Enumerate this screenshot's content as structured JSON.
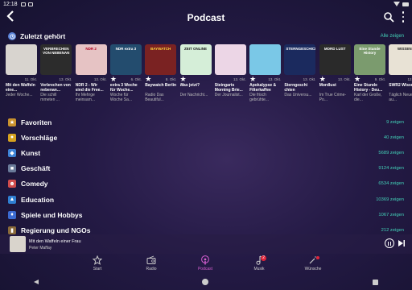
{
  "status_bar": {
    "time": "12:18"
  },
  "appbar": {
    "title": "Podcast"
  },
  "recent": {
    "title": "Zuletzt gehört",
    "show_all": "Alle zeigen",
    "items": [
      {
        "name": "Mit den Waffeln eine...",
        "sub": "Jeder Woche...",
        "date": "11. Okt.",
        "star": false,
        "thumb_bg": "#d8d4cf",
        "thumb_text": "",
        "thumb_color": "#222"
      },
      {
        "name": "Verbrechen von nebenan...",
        "sub": "Die schill mmeten ...",
        "date": "13. Okt.",
        "star": false,
        "thumb_bg": "#2c2c2c",
        "thumb_text": "VERBRECHEN VON NEBENAN",
        "thumb_color": "#fff"
      },
      {
        "name": "NDR 2 - Wir sind die Free...",
        "sub": "Ihr Mehrge meinsam...",
        "date": "13. Okt.",
        "star": false,
        "thumb_bg": "#e6c3c4",
        "thumb_text": "NDR 2",
        "thumb_color": "#b00020"
      },
      {
        "name": "extra 3 Woche für Woche...",
        "sub": "Woche für Woche Sa...",
        "date": "6. Okt.",
        "star": true,
        "thumb_bg": "#234c6e",
        "thumb_text": "NDR extra 3",
        "thumb_color": "#fff"
      },
      {
        "name": "Baywatch Berlin",
        "sub": "Radio Das Beautiful...",
        "date": "8. Okt.",
        "star": true,
        "thumb_bg": "#7a2222",
        "thumb_text": "BAYWATCH",
        "thumb_color": "#ffd33d"
      },
      {
        "name": "Was jetzt?",
        "sub": "Der Nachricht...",
        "date": "",
        "star": true,
        "thumb_bg": "#d5eed8",
        "thumb_text": "ZEIT ONLINE",
        "thumb_color": "#1a1a1a"
      },
      {
        "name": "Steingarts Morning Brie...",
        "sub": "Der Journalist...",
        "date": "13. Okt.",
        "star": false,
        "thumb_bg": "#ecd6e6",
        "thumb_text": "",
        "thumb_color": "#222"
      },
      {
        "name": "Apokalypse & Filterkaffee",
        "sub": "Die frisch gebrühte...",
        "date": "13. Okt.",
        "star": true,
        "thumb_bg": "#7ac8e7",
        "thumb_text": "",
        "thumb_color": "#222"
      },
      {
        "name": "Sterngeschi chten",
        "sub": "Das Universu...",
        "date": "13. Okt.",
        "star": false,
        "thumb_bg": "#1b2a5e",
        "thumb_text": "STERNGESCHICHTEN",
        "thumb_color": "#fff"
      },
      {
        "name": "Mordlust",
        "sub": "Im True Crime-Po...",
        "date": "13. Okt.",
        "star": true,
        "thumb_bg": "#2a2a2a",
        "thumb_text": "MORD LUST",
        "thumb_color": "#fff"
      },
      {
        "name": "Eine Stunde History - Deu...",
        "sub": "Karl der Große, die...",
        "date": "9. Okt.",
        "star": true,
        "thumb_bg": "#7b9b6e",
        "thumb_text": "Eine Stunde History",
        "thumb_color": "#fff"
      },
      {
        "name": "SWR2 Wissen",
        "sub": "Täglich Neues au...",
        "date": "12. Okt.",
        "star": false,
        "thumb_bg": "#e8e2d5",
        "thumb_text": "WISSEN",
        "thumb_color": "#222"
      }
    ]
  },
  "categories": [
    {
      "label": "Favoriten",
      "count": "9 zeigen",
      "icon": "star-icon",
      "glyph": "★",
      "color": "#c9922e"
    },
    {
      "label": "Vorschläge",
      "count": "40 zeigen",
      "icon": "bulb-icon",
      "glyph": "●",
      "color": "#d6a21f"
    },
    {
      "label": "Kunst",
      "count": "5689 zeigen",
      "icon": "palette-icon",
      "glyph": "◆",
      "color": "#3d83d6"
    },
    {
      "label": "Geschäft",
      "count": "9124 zeigen",
      "icon": "briefcase-icon",
      "glyph": "■",
      "color": "#6a7a99"
    },
    {
      "label": "Comedy",
      "count": "6534 zeigen",
      "icon": "comedy-icon",
      "glyph": "☻",
      "color": "#d04c4c"
    },
    {
      "label": "Education",
      "count": "10369 zeigen",
      "icon": "education-icon",
      "glyph": "▲",
      "color": "#2f7fd1"
    },
    {
      "label": "Spiele und Hobbys",
      "count": "1067 zeigen",
      "icon": "games-icon",
      "glyph": "♦",
      "color": "#3b6ad0"
    },
    {
      "label": "Regierung und NGOs",
      "count": "212 zeigen",
      "icon": "government-icon",
      "glyph": "▮",
      "color": "#8a6a3a"
    }
  ],
  "miniplayer": {
    "title": "Mit den Waffeln einer Frau",
    "artist": "Peter Maffay"
  },
  "bottom_nav": [
    {
      "label": "Start",
      "icon": "star-outline-icon"
    },
    {
      "label": "Radio",
      "icon": "radio-icon"
    },
    {
      "label": "Podcast",
      "icon": "podcast-icon",
      "active": true
    },
    {
      "label": "Musik",
      "icon": "music-icon",
      "badge": "2"
    },
    {
      "label": "Wünsche",
      "icon": "magic-wand-icon",
      "dot": true
    }
  ]
}
